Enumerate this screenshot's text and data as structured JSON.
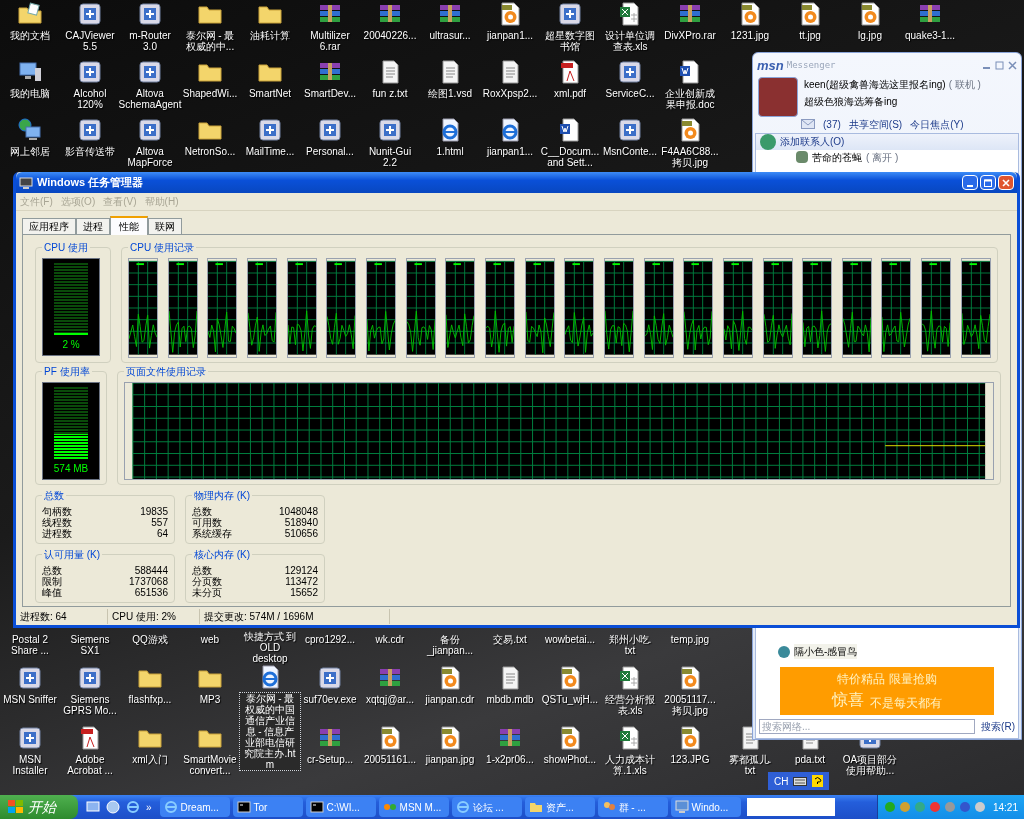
{
  "desktop": {
    "top_rows": [
      [
        {
          "label": "我的文档",
          "kind": "docs",
          "selected": false
        },
        {
          "label": "CAJViewer\n5.5",
          "kind": "app",
          "selected": false
        },
        {
          "label": "m-Router\n3.0",
          "kind": "app",
          "selected": false
        },
        {
          "label": "泰尔网 - 最权威的中...",
          "kind": "folder",
          "selected": false
        },
        {
          "label": "油耗计算",
          "kind": "folder",
          "selected": false
        },
        {
          "label": "Multilizer\n6.rar",
          "kind": "archive",
          "selected": false
        },
        {
          "label": "20040226...",
          "kind": "archive",
          "selected": false
        },
        {
          "label": "ultrasur...",
          "kind": "archive",
          "selected": false
        },
        {
          "label": "jianpan1...",
          "kind": "image",
          "selected": false
        },
        {
          "label": "超星数字图书馆",
          "kind": "app",
          "selected": false
        },
        {
          "label": "设计单位调查表.xls",
          "kind": "excel",
          "selected": false
        },
        {
          "label": "DivXPro.rar",
          "kind": "archive",
          "selected": false
        },
        {
          "label": "1231.jpg",
          "kind": "image",
          "selected": false
        },
        {
          "label": "tt.jpg",
          "kind": "image",
          "selected": false
        },
        {
          "label": "lg.jpg",
          "kind": "image",
          "selected": false
        },
        {
          "label": "quake3-1...",
          "kind": "archive",
          "selected": false
        }
      ],
      [
        {
          "label": "我的电脑",
          "kind": "computer",
          "selected": false
        },
        {
          "label": "Alcohol\n120%",
          "kind": "app",
          "selected": false
        },
        {
          "label": "Altova\nSchemaAgent",
          "kind": "app",
          "selected": false
        },
        {
          "label": "ShapedWi...",
          "kind": "folder",
          "selected": false
        },
        {
          "label": "SmartNet",
          "kind": "folder",
          "selected": false
        },
        {
          "label": "SmartDev...",
          "kind": "archive",
          "selected": false
        },
        {
          "label": "fun z.txt",
          "kind": "text",
          "selected": false
        },
        {
          "label": "绘图1.vsd",
          "kind": "text",
          "selected": false
        },
        {
          "label": "RoxXpsp2...",
          "kind": "text",
          "selected": false
        },
        {
          "label": "xml.pdf",
          "kind": "pdf",
          "selected": false
        },
        {
          "label": "ServiceC...",
          "kind": "app",
          "selected": false
        },
        {
          "label": "企业创新成果申报.doc",
          "kind": "word",
          "selected": false
        }
      ],
      [
        {
          "label": "网上邻居",
          "kind": "network",
          "selected": false
        },
        {
          "label": "影音传送带",
          "kind": "app",
          "selected": false
        },
        {
          "label": "Altova\nMapForce",
          "kind": "app",
          "selected": false
        },
        {
          "label": "NetronSo...",
          "kind": "folder",
          "selected": false
        },
        {
          "label": "MailTime...",
          "kind": "app",
          "selected": false
        },
        {
          "label": "Personal...",
          "kind": "app",
          "selected": false
        },
        {
          "label": "Nunit-Gui\n2.2",
          "kind": "app",
          "selected": false
        },
        {
          "label": "1.html",
          "kind": "web",
          "selected": false
        },
        {
          "label": "jianpan1...",
          "kind": "web",
          "selected": false
        },
        {
          "label": "C__Docum...\nand Sett...",
          "kind": "word",
          "selected": false
        },
        {
          "label": "MsnConte...",
          "kind": "app",
          "selected": false
        },
        {
          "label": "F4AA6C88...\n拷贝.jpg",
          "kind": "image",
          "selected": false
        }
      ]
    ],
    "bottom_rows": [
      [
        {
          "label": "Postal 2\nShare ...",
          "kind": "covered",
          "selected": false
        },
        {
          "label": "Siemens SX1",
          "kind": "covered",
          "selected": false
        },
        {
          "label": "QQ游戏",
          "kind": "covered",
          "selected": false
        },
        {
          "label": "web",
          "kind": "covered",
          "selected": false
        },
        {
          "label": "快捷方式 到OLD desktop",
          "kind": "covered",
          "selected": false
        },
        {
          "label": "cpro1292...",
          "kind": "covered",
          "selected": false
        },
        {
          "label": "wk.cdr",
          "kind": "covered",
          "selected": false
        },
        {
          "label": "备份\n_jianpan...",
          "kind": "covered",
          "selected": false
        },
        {
          "label": "交易.txt",
          "kind": "covered",
          "selected": false
        },
        {
          "label": "wowbetai...",
          "kind": "covered",
          "selected": false
        },
        {
          "label": "郑州小吃.\ntxt",
          "kind": "covered",
          "selected": false
        },
        {
          "label": "temp.jpg",
          "kind": "covered",
          "selected": false
        }
      ],
      [
        {
          "label": "MSN Sniffer",
          "kind": "app",
          "selected": false
        },
        {
          "label": "Siemens\nGPRS Mo...",
          "kind": "app",
          "selected": false
        },
        {
          "label": "flashfxp...",
          "kind": "folder",
          "selected": false
        },
        {
          "label": "MP3",
          "kind": "folder",
          "selected": false
        },
        {
          "label": "泰尔网 - 最权威的中国通信产业信息 - 信息产业部电信研究院主办.htm",
          "kind": "web",
          "selected": true
        },
        {
          "label": "suf70ev.exe",
          "kind": "app",
          "selected": false
        },
        {
          "label": "xqtqj@ar...",
          "kind": "archive",
          "selected": false
        },
        {
          "label": "jianpan.cdr",
          "kind": "image",
          "selected": false
        },
        {
          "label": "mbdb.mdb",
          "kind": "text",
          "selected": false
        },
        {
          "label": "QSTu_wjH...",
          "kind": "image",
          "selected": false
        },
        {
          "label": "经营分析报表.xls",
          "kind": "excel",
          "selected": false
        },
        {
          "label": "20051117...\n拷贝.jpg",
          "kind": "image",
          "selected": false
        }
      ],
      [
        {
          "label": "MSN\nInstaller",
          "kind": "app",
          "selected": false
        },
        {
          "label": "Adobe\nAcrobat ...",
          "kind": "pdf",
          "selected": false
        },
        {
          "label": "xml入门",
          "kind": "folder",
          "selected": false
        },
        {
          "label": "SmartMovie\nconvert...",
          "kind": "folder",
          "selected": false
        },
        null,
        {
          "label": "cr-Setup...",
          "kind": "archive",
          "selected": false
        },
        {
          "label": "20051161...",
          "kind": "image",
          "selected": false
        },
        {
          "label": "jianpan.jpg",
          "kind": "image",
          "selected": false
        },
        {
          "label": "1-x2pr06...",
          "kind": "archive",
          "selected": false
        },
        {
          "label": "showPhot...",
          "kind": "image",
          "selected": false
        },
        {
          "label": "人力成本计算.1.xls",
          "kind": "excel",
          "selected": false
        },
        {
          "label": "123.JPG",
          "kind": "image",
          "selected": false
        },
        {
          "label": "雾都孤儿.\ntxt",
          "kind": "text",
          "selected": false
        },
        {
          "label": "pda.txt",
          "kind": "text",
          "selected": false
        },
        {
          "label": "OA项目部分使用帮助...",
          "kind": "app",
          "selected": false
        }
      ]
    ]
  },
  "task_manager": {
    "title": "Windows 任务管理器",
    "menu": [
      {
        "label": "文件(F)",
        "disabled": true
      },
      {
        "label": "选项(O)",
        "disabled": true
      },
      {
        "label": "查看(V)",
        "disabled": true
      },
      {
        "label": "帮助(H)",
        "disabled": true
      }
    ],
    "tabs": [
      {
        "label": "应用程序",
        "selected": false
      },
      {
        "label": "进程",
        "selected": false
      },
      {
        "label": "性能",
        "selected": true
      },
      {
        "label": "联网",
        "selected": false
      }
    ],
    "cpu_usage": {
      "title": "CPU 使用",
      "reading": "2 %",
      "level": 0.02
    },
    "cpu_history": {
      "title": "CPU 使用记录"
    },
    "pf_usage": {
      "title": "PF 使用率",
      "reading": "574 MB",
      "level": 0.35
    },
    "pf_history": {
      "title": "页面文件使用记录"
    },
    "stats": [
      {
        "title": "总数",
        "rows": [
          {
            "label": "句柄数",
            "value": "19835"
          },
          {
            "label": "线程数",
            "value": "557"
          },
          {
            "label": "进程数",
            "value": "64"
          }
        ]
      },
      {
        "title": "物理内存 (K)",
        "rows": [
          {
            "label": "总数",
            "value": "1048048"
          },
          {
            "label": "可用数",
            "value": "518940"
          },
          {
            "label": "系统缓存",
            "value": "510656"
          }
        ]
      },
      {
        "title": "认可用量 (K)",
        "rows": [
          {
            "label": "总数",
            "value": "588444"
          },
          {
            "label": "限制",
            "value": "1737068"
          },
          {
            "label": "峰值",
            "value": "651536"
          }
        ]
      },
      {
        "title": "核心内存 (K)",
        "rows": [
          {
            "label": "总数",
            "value": "129124"
          },
          {
            "label": "分页数",
            "value": "113472"
          },
          {
            "label": "未分页",
            "value": "15652"
          }
        ]
      }
    ],
    "status_bar": [
      "进程数: 64",
      "CPU 使用: 2%",
      "提交更改: 574M / 1696M"
    ]
  },
  "messenger": {
    "brand": "msn",
    "title": "Messenger",
    "user": "keen(超级禽兽海选这里报名ing)",
    "status": "( 联机 )",
    "personal_message": "超级色狼海选筹备ing",
    "mail_count": "(37)",
    "links": [
      "共享空间(S)",
      "今日焦点(Y)"
    ],
    "add_contact": "添加联系人(O)",
    "contacts_top": [
      {
        "name": "苦命的苍蝇",
        "status": "( 离开 )"
      }
    ],
    "contacts_bottom": [
      {
        "name": "隔小色-感冒鸟"
      }
    ],
    "ad": {
      "line_1": "特价精品  限量抢购",
      "big": "惊喜",
      "line_2": "不是每天都有"
    },
    "search": {
      "placeholder": "搜索网络...",
      "button": "搜索(R)"
    }
  },
  "language_bar": {
    "label": "CH"
  },
  "taskbar": {
    "start": "开始",
    "more": "»",
    "tasks": [
      {
        "label": "Dream...",
        "kind": "web",
        "selected": false
      },
      {
        "label": "Tor",
        "kind": "console",
        "selected": false
      },
      {
        "label": "C:\\WI...",
        "kind": "console",
        "selected": false
      },
      {
        "label": "MSN M...",
        "kind": "msn",
        "selected": false
      },
      {
        "label": "论坛 ...",
        "kind": "web",
        "selected": false
      },
      {
        "label": "资产...",
        "kind": "folder",
        "selected": false
      },
      {
        "label": "群 - ...",
        "kind": "group",
        "selected": false
      },
      {
        "label": "Windo...",
        "kind": "monitor",
        "selected": false
      }
    ],
    "clock": "14:21"
  }
}
